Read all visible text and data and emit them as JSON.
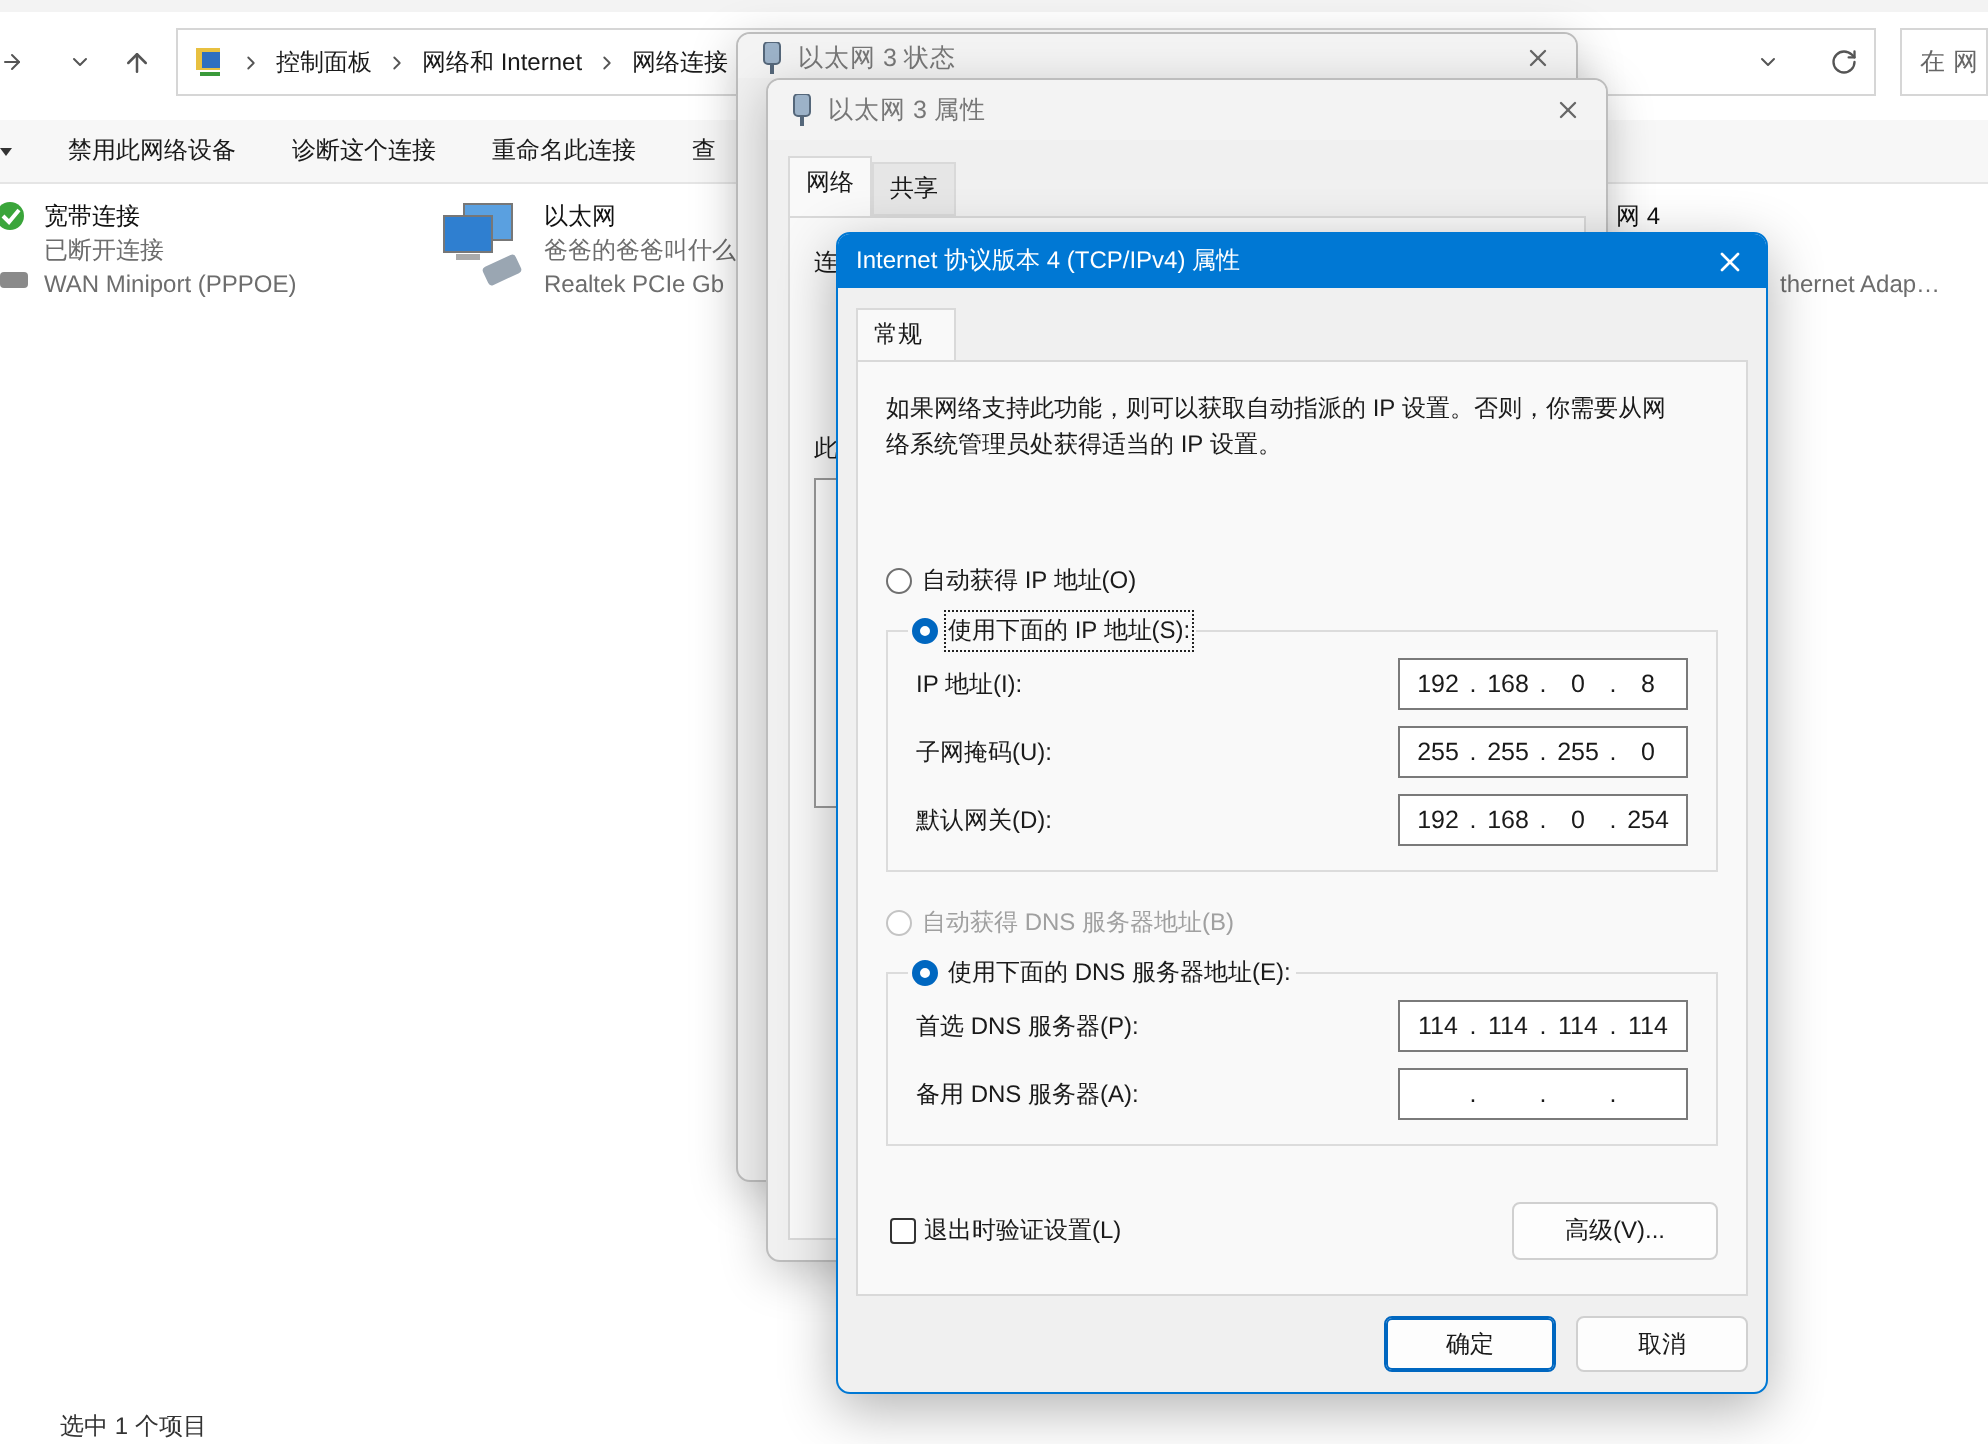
{
  "explorer": {
    "breadcrumb": [
      "控制面板",
      "网络和 Internet",
      "网络连接"
    ],
    "search_placeholder": "在 网",
    "toolbar": [
      "禁用此网络设备",
      "诊断这个连接",
      "重命名此连接",
      "查"
    ],
    "connections": [
      {
        "kind": "dialup",
        "name": "宽带连接",
        "status": "已断开连接",
        "device": "WAN Miniport (PPPOE)"
      },
      {
        "kind": "ethernet",
        "name": "以太网",
        "status": "爸爸的爸爸叫什么",
        "device": "Realtek PCIe Gb"
      },
      {
        "kind": "partial",
        "name": "网 4",
        "device": "thernet Adap…"
      }
    ],
    "status_bar": "选中 1 个项目"
  },
  "status_window": {
    "title": "以太网 3 状态"
  },
  "properties_window": {
    "title": "以太网 3 属性",
    "tabs": [
      {
        "label": "网络",
        "selected": true
      },
      {
        "label": "共享",
        "selected": false
      }
    ],
    "labels": [
      "连",
      "此"
    ]
  },
  "ipv4_dialog": {
    "title": "Internet 协议版本 4 (TCP/IPv4) 属性",
    "tabs": [
      {
        "label": "常规",
        "selected": true
      }
    ],
    "description": "如果网络支持此功能，则可以获取自动指派的 IP 设置。否则，你需要从网络系统管理员处获得适当的 IP 设置。",
    "separator": ".",
    "ip_mode": [
      {
        "label": "自动获得 IP 地址(O)",
        "selected": false,
        "disabled": false,
        "focused": false
      },
      {
        "label": "使用下面的 IP 地址(S):",
        "selected": true,
        "disabled": false,
        "focused": true
      }
    ],
    "ip_fields": [
      {
        "label": "IP 地址(I):",
        "octets": [
          "192",
          "168",
          "0",
          "8"
        ]
      },
      {
        "label": "子网掩码(U):",
        "octets": [
          "255",
          "255",
          "255",
          "0"
        ]
      },
      {
        "label": "默认网关(D):",
        "octets": [
          "192",
          "168",
          "0",
          "254"
        ]
      }
    ],
    "dns_mode": [
      {
        "label": "自动获得 DNS 服务器地址(B)",
        "selected": false,
        "disabled": true,
        "focused": false
      },
      {
        "label": "使用下面的 DNS 服务器地址(E):",
        "selected": true,
        "disabled": false,
        "focused": false
      }
    ],
    "dns_fields": [
      {
        "label": "首选 DNS 服务器(P):",
        "octets": [
          "114",
          "114",
          "114",
          "114"
        ]
      },
      {
        "label": "备用 DNS 服务器(A):"
      }
    ],
    "validate": {
      "label": "退出时验证设置(L)",
      "checked": false
    },
    "advanced_button": "高级(V)...",
    "buttons": [
      {
        "label": "确定",
        "default": true
      },
      {
        "label": "取消",
        "default": false
      }
    ]
  }
}
